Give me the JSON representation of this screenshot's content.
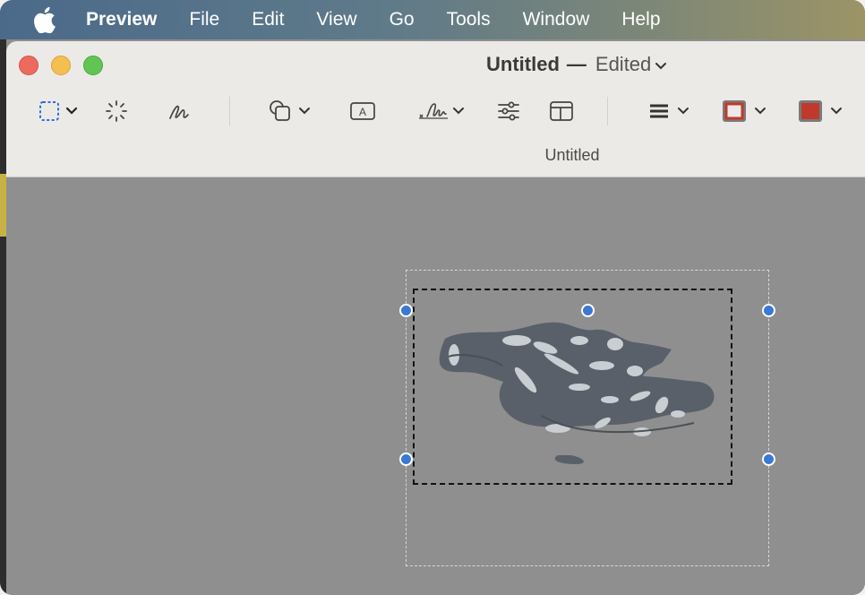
{
  "menubar": {
    "app": "Preview",
    "items": [
      "File",
      "Edit",
      "View",
      "Go",
      "Tools",
      "Window",
      "Help"
    ]
  },
  "window": {
    "title": "Untitled",
    "separator": "—",
    "status": "Edited",
    "page_label": "Untitled"
  },
  "toolbar": {
    "tools": [
      "rectangular-selection",
      "instant-alpha",
      "sketch",
      "shapes",
      "text",
      "sign",
      "adjust-color",
      "adjust-size",
      "shape-style",
      "border-color",
      "fill-color"
    ]
  },
  "colors": {
    "border_color": "#c0392b",
    "fill_color": "#c0392b",
    "handle": "#3a79d4",
    "canvas": "#8f8f8f"
  }
}
